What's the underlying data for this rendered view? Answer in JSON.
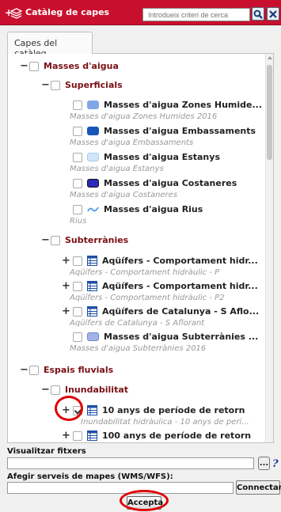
{
  "header": {
    "title": "Catàleg de capes",
    "search_placeholder": "Introdueix criteri de cerca"
  },
  "tabs": [
    {
      "label": "Capes del catàleg"
    }
  ],
  "tree": {
    "masses": {
      "label": "Masses d'aigua"
    },
    "superficials": {
      "label": "Superficials"
    },
    "layers_sup": [
      {
        "label": "Masses d'aigua Zones Humide...",
        "subtitle": "Masses d'aigua Zones Humides 2016",
        "color": "#7fa7e6"
      },
      {
        "label": "Masses d'aigua Embassaments",
        "subtitle": "Masses d'aigua Embassaments",
        "color": "#1656b8"
      },
      {
        "label": "Masses d'aigua Estanys",
        "subtitle": "Masses d'aigua Estanys",
        "color": "#cfe6fb"
      },
      {
        "label": "Masses d'aigua Costaneres",
        "subtitle": "Masses d'aigua Costaneres",
        "color": "#2a2ab8"
      },
      {
        "label": "Masses d'aigua Rius",
        "subtitle": "Rius",
        "color": "#3a8ff0"
      }
    ],
    "subterranies": {
      "label": "Subterrànies"
    },
    "layers_sub": [
      {
        "label": "Aqüífers - Comportament hidr...",
        "subtitle": "Aqüífers - Comportament hidràulic - P"
      },
      {
        "label": "Aqüífers - Comportament hidr...",
        "subtitle": "Aqüífers - Comportament hidràulic - P2"
      },
      {
        "label": "Aqüífers de Catalunya - S Aflo...",
        "subtitle": "Aqüífers de Catalunya - S Aflorant"
      },
      {
        "label": "Masses d'aigua Subterrànies ...",
        "subtitle": "Masses d'aigua Subterrànies 2016",
        "color": "#9fb3ea"
      }
    ],
    "espais": {
      "label": "Espais fluvials"
    },
    "inundabilitat": {
      "label": "Inundabilitat"
    },
    "layers_inund": [
      {
        "label": "10 anys de període de retorn",
        "subtitle": "Inundabilitat hidràulica - 10 anys de perí..."
      },
      {
        "label": "100 anys de període de retorn"
      }
    ]
  },
  "bottom": {
    "visualitzar_label": "Visualitzar fitxers",
    "browse_label": "...",
    "wms_label": "Afegir serveis de mapes (WMS/WFS):",
    "connect_label": "Connectar",
    "accept_label": "Accepta"
  },
  "colors": {
    "titlebar": "#c8102e",
    "group_text": "#7a0f14",
    "annotation": "#e00000"
  }
}
